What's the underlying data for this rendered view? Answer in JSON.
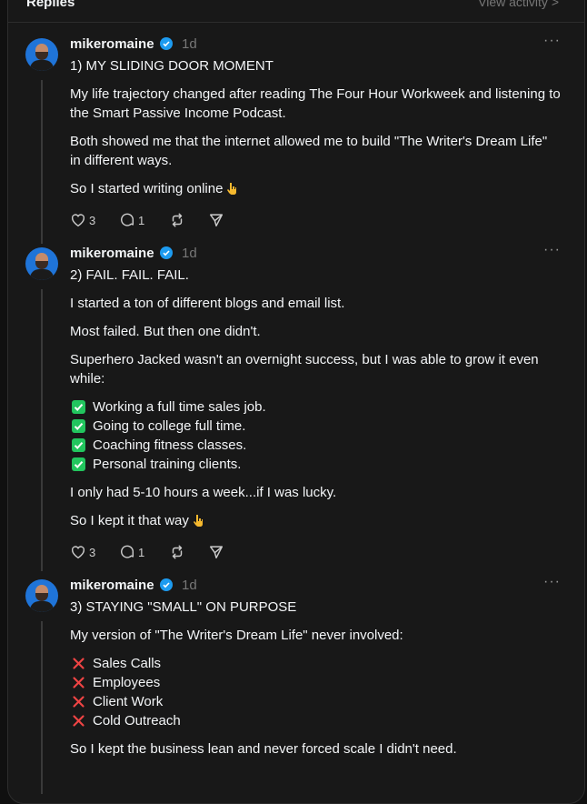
{
  "header": {
    "title": "Replies",
    "sort": "View activity >"
  },
  "colors": {
    "background": "#181818",
    "text": "#f3f5f7",
    "muted": "#777777",
    "verified": "#1d9bf0",
    "check": "#22c55e",
    "cross": "#ef4444"
  },
  "posts": [
    {
      "username": "mikeromaine",
      "time": "1d",
      "heading": "1) MY SLIDING DOOR MOMENT",
      "p1a": "My life trajectory changed after reading The Four Hour Workweek and listening to",
      "p1b": "the Smart Passive Income Podcast.",
      "p2a": "Both showed me that the internet allowed me to build \"The Writer's Dream Life\"",
      "p2b": "in different ways.",
      "p3": "So I started writing online",
      "likes": "3",
      "replies": "1",
      "icons": [
        "heart-icon",
        "comment-icon",
        "repost-icon",
        "share-icon",
        "more-icon",
        "verified-icon",
        "pointing-down-icon"
      ]
    },
    {
      "username": "mikeromaine",
      "time": "1d",
      "heading": "2) FAIL. FAIL. FAIL.",
      "p1": "I started a ton of different blogs and email list.",
      "p2": "Most failed. But then one didn't.",
      "p3a": "Superhero Jacked wasn't an overnight success, but I was able to grow it even",
      "p3b": "while:",
      "bullets": [
        "Working a full time sales job.",
        "Going to college full time.",
        "Coaching fitness classes.",
        "Personal training clients."
      ],
      "bullet_icon": "check-mark-icon",
      "p4": "I only had 5-10 hours a week...if I was lucky.",
      "p5": "So I kept it that way",
      "likes": "3",
      "replies": "1"
    },
    {
      "username": "mikeromaine",
      "time": "1d",
      "heading": "3) STAYING \"SMALL\" ON PURPOSE",
      "p1": "My version of \"The Writer's Dream Life\" never involved:",
      "bullets": [
        "Sales Calls",
        "Employees",
        "Client Work",
        "Cold Outreach"
      ],
      "bullet_icon": "cross-mark-icon",
      "p2": "So I kept the business lean and never forced scale I didn't need."
    }
  ]
}
